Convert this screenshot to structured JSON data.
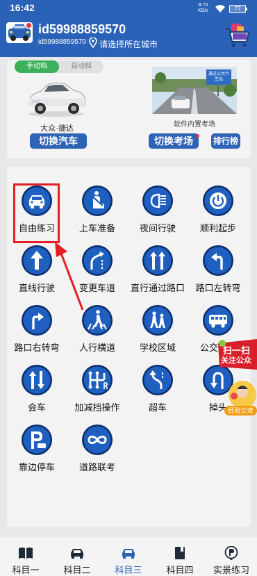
{
  "status_bar": {
    "time": "16:42",
    "net_speed": "8.70",
    "net_unit": "KB/s",
    "battery": "77"
  },
  "header": {
    "user_name": "id59988859570",
    "user_id": "id59988859570",
    "city_prompt": "请选择所在城市",
    "bg_color": "#2a62b8"
  },
  "vehicle_card": {
    "tabs": [
      "手动档",
      "自动档"
    ],
    "active_tab": "手动档",
    "car_model": "大众·捷达",
    "switch_car_label": "切换汽车",
    "sign_text": "通过公共汽车站",
    "scene_caption": "软件内置考场",
    "switch_scene_label": "切换考场",
    "ranking_label": "排行榜"
  },
  "practice_items": [
    {
      "label": "自由练习",
      "icon": "car-front-icon"
    },
    {
      "label": "上车准备",
      "icon": "seatbelt-icon"
    },
    {
      "label": "夜间行驶",
      "icon": "headlight-icon"
    },
    {
      "label": "顺利起步",
      "icon": "power-icon"
    },
    {
      "label": "直线行驶",
      "icon": "arrow-up-icon"
    },
    {
      "label": "变更车道",
      "icon": "lane-change-icon"
    },
    {
      "label": "直行通过路口",
      "icon": "straight-lanes-icon"
    },
    {
      "label": "路口左转弯",
      "icon": "turn-left-icon"
    },
    {
      "label": "路口右转弯",
      "icon": "turn-right-icon"
    },
    {
      "label": "人行横道",
      "icon": "crosswalk-icon"
    },
    {
      "label": "学校区域",
      "icon": "school-icon"
    },
    {
      "label": "公交车站",
      "icon": "bus-icon"
    },
    {
      "label": "会车",
      "icon": "two-way-icon"
    },
    {
      "label": "加减挡操作",
      "icon": "gear-shift-icon"
    },
    {
      "label": "超车",
      "icon": "overtake-icon"
    },
    {
      "label": "掉头",
      "icon": "u-turn-icon"
    },
    {
      "label": "靠边停车",
      "icon": "parking-icon"
    },
    {
      "label": "道路联考",
      "icon": "infinity-icon"
    }
  ],
  "floating_badges": {
    "scan_line1": "扫一扫",
    "scan_line2": "关注公众",
    "exchange_label": "经验交流"
  },
  "bottom_nav": {
    "items": [
      {
        "label": "科目一",
        "icon": "book-icon"
      },
      {
        "label": "科目二",
        "icon": "car-icon"
      },
      {
        "label": "科目三",
        "icon": "car-icon"
      },
      {
        "label": "科目四",
        "icon": "bookmark-book-icon"
      },
      {
        "label": "实景练习",
        "icon": "location-p-icon"
      }
    ],
    "active": "科目三",
    "active_color": "#2c63b5"
  },
  "colors": {
    "accent_blue": "#2f63b6",
    "sign_blue": "#1f5fbf",
    "tab_green": "#3ab15a",
    "highlight_red": "#e31e24"
  }
}
